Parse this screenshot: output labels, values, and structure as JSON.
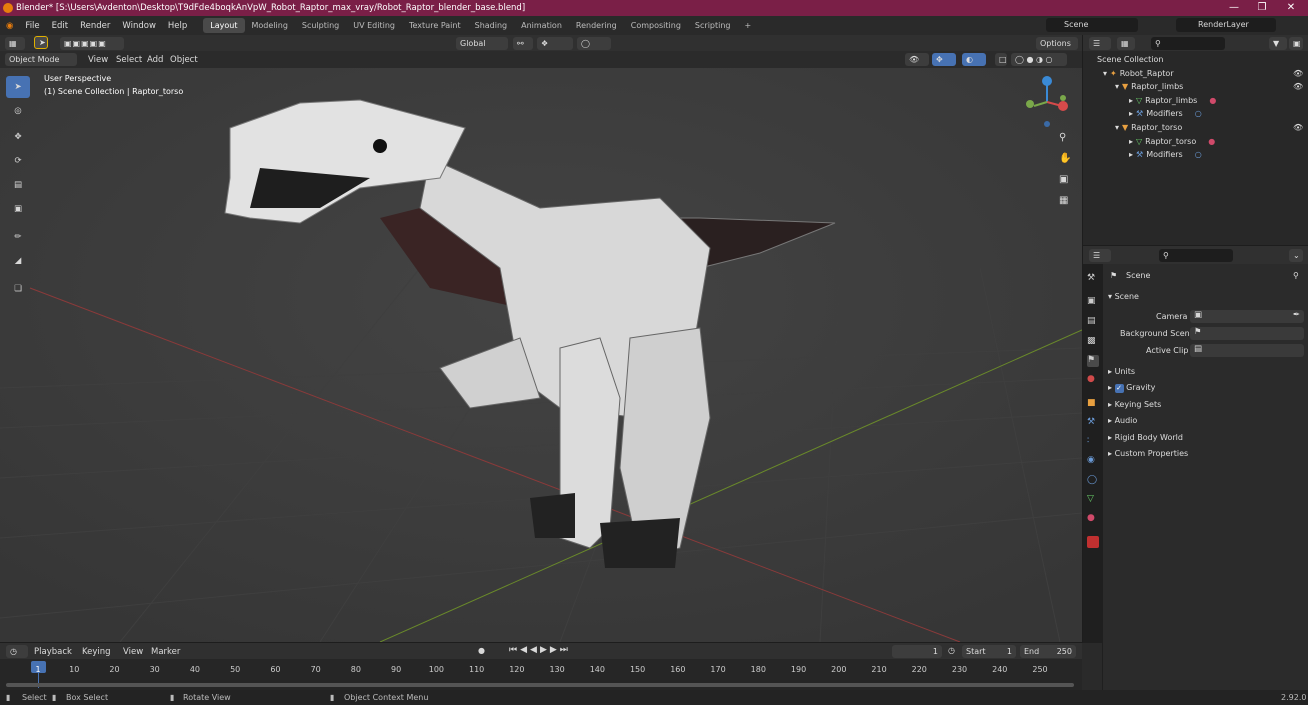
{
  "window": {
    "title": "Blender* [S:\\Users\\Avdenton\\Desktop\\T9dFde4boqkAnVpW_Robot_Raptor_max_vray/Robot_Raptor_blender_base.blend]"
  },
  "menu": [
    "File",
    "Edit",
    "Render",
    "Window",
    "Help"
  ],
  "workspaces": [
    "Layout",
    "Modeling",
    "Sculpting",
    "UV Editing",
    "Texture Paint",
    "Shading",
    "Animation",
    "Rendering",
    "Compositing",
    "Scripting"
  ],
  "active_workspace": "Layout",
  "scene": {
    "name": "Scene",
    "render_layer": "RenderLayer"
  },
  "viewport": {
    "mode": "Object Mode",
    "menus": [
      "View",
      "Select",
      "Add",
      "Object"
    ],
    "transform_orientation": "Global",
    "options_label": "Options",
    "overlay_line1": "User Perspective",
    "overlay_line2": "(1) Scene Collection | Raptor_torso"
  },
  "outliner": {
    "root": "Scene Collection",
    "items": [
      {
        "label": "Robot_Raptor",
        "level": 1
      },
      {
        "label": "Raptor_limbs",
        "level": 2
      },
      {
        "label": "Raptor_limbs",
        "level": 3
      },
      {
        "label": "Modifiers",
        "level": 3
      },
      {
        "label": "Raptor_torso",
        "level": 2
      },
      {
        "label": "Raptor_torso",
        "level": 3
      },
      {
        "label": "Modifiers",
        "level": 3
      }
    ]
  },
  "properties": {
    "context": "Scene",
    "panel": "Scene",
    "camera_label": "Camera",
    "background_scene_label": "Background Scene",
    "active_clip_label": "Active Clip",
    "sections": [
      "Units",
      "Gravity",
      "Keying Sets",
      "Audio",
      "Rigid Body World",
      "Custom Properties"
    ],
    "gravity_checked": true
  },
  "timeline": {
    "menus": [
      "Playback",
      "Keying",
      "View",
      "Marker"
    ],
    "current_frame": "1",
    "start_label": "Start",
    "start": "1",
    "end_label": "End",
    "end": "250",
    "ticks": [
      "1",
      "10",
      "20",
      "30",
      "40",
      "50",
      "60",
      "70",
      "80",
      "90",
      "100",
      "110",
      "120",
      "130",
      "140",
      "150",
      "160",
      "170",
      "180",
      "190",
      "200",
      "210",
      "220",
      "230",
      "240",
      "250"
    ]
  },
  "statusbar": {
    "items": [
      "Select",
      "Box Select",
      "Rotate View",
      "Object Context Menu"
    ],
    "version": "2.92.0"
  },
  "colors": {
    "accent": "#4772b3",
    "title_bg": "#7a1f47",
    "orange": "#e87d0d"
  }
}
